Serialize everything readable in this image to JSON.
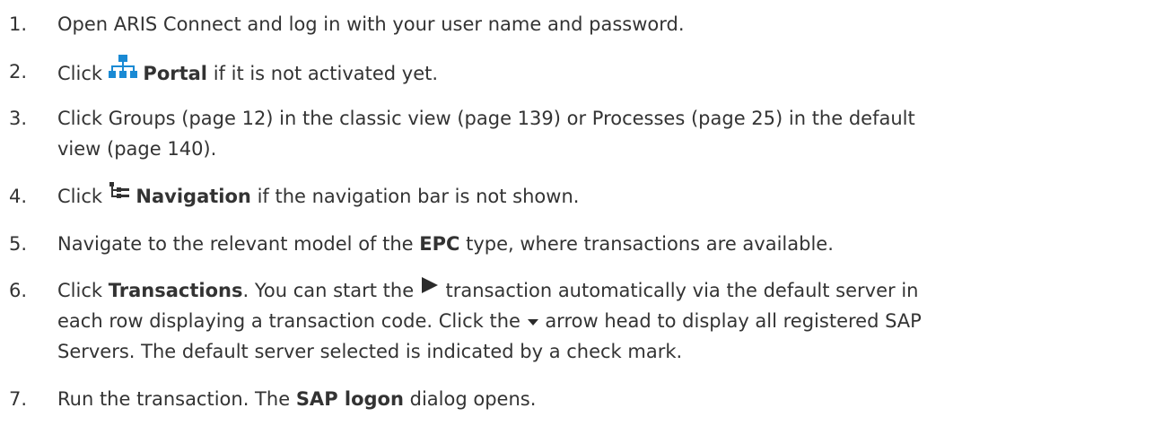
{
  "steps": [
    {
      "number": "1.",
      "text": "Open ARIS Connect and log in with your user name and password."
    },
    {
      "number": "2.",
      "before": "Click",
      "icon": "portal-icon",
      "bold": "Portal",
      "after": "if it is not activated yet."
    },
    {
      "number": "3.",
      "line1": "Click Groups (page 12) in the classic view (page 139) or Processes (page 25) in the default",
      "line2": "view (page 140)."
    },
    {
      "number": "4.",
      "before": "Click",
      "icon": "navigation-icon",
      "bold": "Navigation",
      "after": "if the navigation bar is not shown."
    },
    {
      "number": "5.",
      "before": "Navigate to the relevant model of the",
      "bold": "EPC",
      "after": "type, where transactions are available."
    },
    {
      "number": "6.",
      "before": "Click",
      "bold": "Transactions",
      "mid": ". You can start the",
      "icon1": "play-icon",
      "after1": "transaction automatically via the default server in",
      "line2_before": "each row displaying a transaction code. Click the",
      "icon2": "arrow-head-down-icon",
      "line2_after": "arrow head to display all registered SAP",
      "line3": "Servers. The default server selected is indicated by a check mark."
    },
    {
      "number": "7.",
      "before": "Run the transaction. The",
      "bold": "SAP logon",
      "after": "dialog opens."
    }
  ],
  "colors": {
    "text": "#333333",
    "portal_icon": "#1a8ad4",
    "play_icon": "#2b2b2b",
    "navigation_icon": "#333333"
  }
}
